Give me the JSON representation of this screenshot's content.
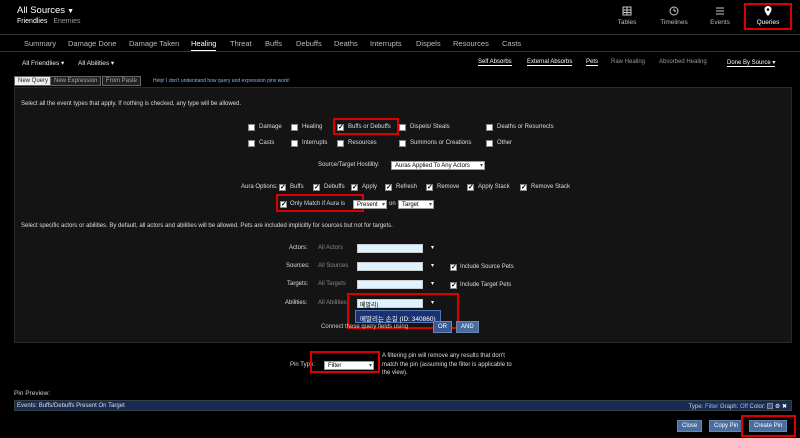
{
  "header": {
    "title": "All Sources",
    "sub_active": "Friendlies",
    "sub_inactive": "Enemies",
    "nav": [
      {
        "label": "Tables",
        "icon": "grid-icon"
      },
      {
        "label": "Timelines",
        "icon": "clock-icon"
      },
      {
        "label": "Events",
        "icon": "list-icon"
      },
      {
        "label": "Queries",
        "icon": "pin-icon"
      }
    ]
  },
  "tabs": [
    "Summary",
    "Damage Done",
    "Damage Taken",
    "Healing",
    "Threat",
    "Buffs",
    "Debuffs",
    "Deaths",
    "Interrupts",
    "Dispels",
    "Resources",
    "Casts"
  ],
  "selected_tab": "Healing",
  "filters": {
    "friendlies": "All Friendlies",
    "abilities": "All Abilities",
    "self_absorbs": "Self Absorbs",
    "external_absorbs": "External Absorbs",
    "pets": "Pets",
    "raw_healing": "Raw Healing",
    "absorbed_healing": "Absorbed Healing",
    "done_by": "Done By Source"
  },
  "query_tabs": [
    "New Query",
    "New Expression",
    "From Paste"
  ],
  "help_text": "Help! I don't understand how query and expression pins work!",
  "event_types": {
    "intro": "Select all the event types that apply. If nothing is checked, any type will be allowed.",
    "row1": [
      "Damage",
      "Healing",
      "Buffs or Debuffs",
      "Dispels/ Steals",
      "Deaths or Resurrects"
    ],
    "row2": [
      "Casts",
      "Interrupts",
      "Resources",
      "Summons or Creations",
      "Other"
    ]
  },
  "hostility": {
    "label": "Source/Target Hostility:",
    "value": "Auras Applied To Any Actors"
  },
  "aura": {
    "label": "Aura Options:",
    "options": [
      "Buffs",
      "Debuffs",
      "Apply",
      "Refresh",
      "Remove",
      "Apply Stack",
      "Remove Stack"
    ],
    "only_match": "Only Match if Aura is",
    "state": "Present",
    "on": "on",
    "target": "Target"
  },
  "actors": {
    "intro": "Select specific actors or abilities. By default, all actors and abilities will be allowed. Pets are included implicitly for sources but not for targets.",
    "actors_label": "Actors:",
    "actors_ph": "All Actors",
    "sources_label": "Sources:",
    "sources_ph": "All Sources",
    "include_source_pets": "Include Source Pets",
    "targets_label": "Targets:",
    "targets_ph": "All Targets",
    "include_target_pets": "Include Target Pets",
    "abilities_label": "Abilities:",
    "abilities_ph": "All Abilities",
    "abilities_value": "메말리|",
    "suggestion": "메말리는 손길 (ID: 340860)",
    "connect_text": "Connect these query fields using",
    "or": "OR",
    "and": "AND"
  },
  "pin": {
    "type_label": "Pin Type:",
    "type_value": "Filter",
    "desc": "A filtering pin will remove any results that don't match the pin (assuming the filter is applicable to the view)."
  },
  "preview": {
    "label": "Pin Preview:",
    "events": "Events:",
    "events_value": "Buffs/Debuffs Present On Target",
    "type_label": "Type:",
    "type_value": "Filter",
    "graph_label": "Graph:",
    "graph_value": "Off",
    "color_label": "Color:"
  },
  "buttons": {
    "close": "Close",
    "copy": "Copy Pin",
    "create": "Create Pin"
  }
}
